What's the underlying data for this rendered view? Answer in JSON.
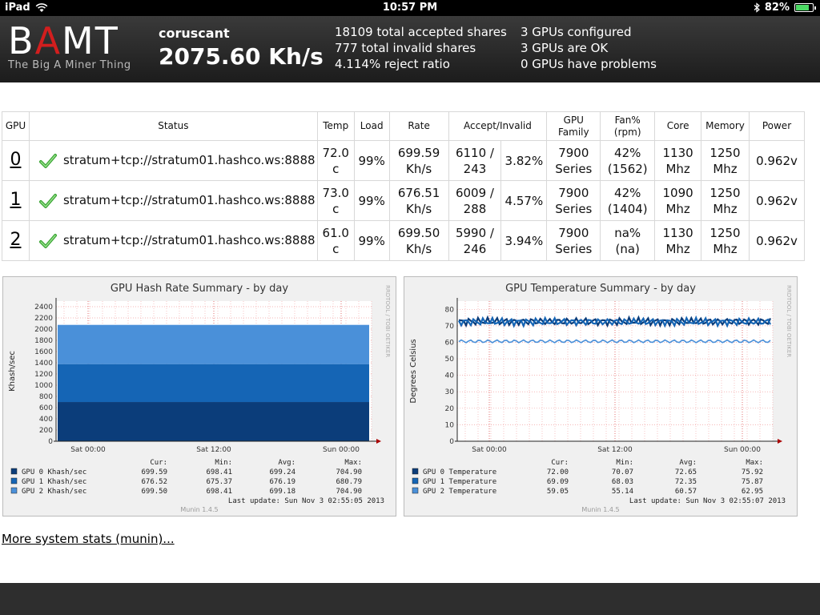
{
  "status_bar": {
    "device": "iPad",
    "time": "10:57 PM",
    "battery": "82%",
    "battery_level": 0.82
  },
  "header": {
    "logo_main": "BAMT",
    "logo_sub": "The Big A Miner Thing",
    "host": "coruscant",
    "hashrate": "2075.60 Kh/s",
    "accepted": "18109 total accepted shares",
    "invalid": "777 total invalid shares",
    "reject": "4.114% reject ratio",
    "configured": "3 GPUs configured",
    "ok": "3 GPUs are OK",
    "problems": "0 GPUs have problems"
  },
  "table": {
    "headers": {
      "gpu": "GPU",
      "status": "Status",
      "temp": "Temp",
      "load": "Load",
      "rate": "Rate",
      "accept": "Accept/Invalid",
      "family_1": "GPU",
      "family_2": "Family",
      "fan_1": "Fan%",
      "fan_2": "(rpm)",
      "core": "Core",
      "memory": "Memory",
      "power": "Power"
    },
    "rows": [
      {
        "gpu": "0",
        "status": "stratum+tcp://stratum01.hashco.ws:8888",
        "temp_1": "72.0",
        "temp_2": "c",
        "load": "99%",
        "rate_1": "699.59",
        "rate_2": "Kh/s",
        "acc_1": "6110 /",
        "acc_2": "243",
        "rej": "3.82%",
        "fam_1": "7900",
        "fam_2": "Series",
        "fan_1": "42%",
        "fan_2": "(1562)",
        "core_1": "1130",
        "core_2": "Mhz",
        "mem_1": "1250",
        "mem_2": "Mhz",
        "power": "0.962v"
      },
      {
        "gpu": "1",
        "status": "stratum+tcp://stratum01.hashco.ws:8888",
        "temp_1": "73.0",
        "temp_2": "c",
        "load": "99%",
        "rate_1": "676.51",
        "rate_2": "Kh/s",
        "acc_1": "6009 /",
        "acc_2": "288",
        "rej": "4.57%",
        "fam_1": "7900",
        "fam_2": "Series",
        "fan_1": "42%",
        "fan_2": "(1404)",
        "core_1": "1090",
        "core_2": "Mhz",
        "mem_1": "1250",
        "mem_2": "Mhz",
        "power": "0.962v"
      },
      {
        "gpu": "2",
        "status": "stratum+tcp://stratum01.hashco.ws:8888",
        "temp_1": "61.0",
        "temp_2": "c",
        "load": "99%",
        "rate_1": "699.50",
        "rate_2": "Kh/s",
        "acc_1": "5990 /",
        "acc_2": "246",
        "rej": "3.94%",
        "fam_1": "7900",
        "fam_2": "Series",
        "fan_1": "na%",
        "fan_2": "(na)",
        "core_1": "1130",
        "core_2": "Mhz",
        "mem_1": "1250",
        "mem_2": "Mhz",
        "power": "0.962v"
      }
    ]
  },
  "hash_chart": {
    "title": "GPU Hash Rate Summary - by day",
    "ylabel": "Khash/sec",
    "side_label": "RRDTOOL / TOBI OETIKER",
    "y_ticks": [
      "0",
      "200",
      "400",
      "600",
      "800",
      "1000",
      "1200",
      "1400",
      "1600",
      "1800",
      "2000",
      "2200",
      "2400"
    ],
    "ylim": [
      0,
      2500
    ],
    "x_ticks": [
      "Sat 00:00",
      "Sat 12:00",
      "Sun 00:00"
    ],
    "stack_values": [
      699.59,
      676.52,
      699.5
    ],
    "colors": [
      "#0b3d7a",
      "#1565b5",
      "#4a90d9"
    ],
    "col_headers": [
      "Cur:",
      "Min:",
      "Avg:",
      "Max:"
    ],
    "legend": [
      {
        "name": "GPU 0 Khash/sec",
        "cur": "699.59",
        "min": "698.41",
        "avg": "699.24",
        "max": "704.90"
      },
      {
        "name": "GPU 1 Khash/sec",
        "cur": "676.52",
        "min": "675.37",
        "avg": "676.19",
        "max": "680.79"
      },
      {
        "name": "GPU 2 Khash/sec",
        "cur": "699.50",
        "min": "698.41",
        "avg": "699.18",
        "max": "704.90"
      }
    ],
    "last_update": "Last update:  Sun Nov  3 02:55:05 2013",
    "munin": "Munin 1.4.5"
  },
  "temp_chart": {
    "title": "GPU Temperature Summary - by day",
    "ylabel": "Degrees Celsius",
    "side_label": "RRDTOOL / TOBI OETIKER",
    "y_ticks": [
      "0",
      "10",
      "20",
      "30",
      "40",
      "50",
      "60",
      "70",
      "80"
    ],
    "ylim": [
      0,
      85
    ],
    "x_ticks": [
      "Sat 00:00",
      "Sat 12:00",
      "Sun 00:00"
    ],
    "lines": [
      72.6,
      72.4,
      60.6
    ],
    "colors": [
      "#0b3d7a",
      "#1565b5",
      "#4a90d9"
    ],
    "col_headers": [
      "Cur:",
      "Min:",
      "Avg:",
      "Max:"
    ],
    "legend": [
      {
        "name": "GPU 0 Temperature",
        "cur": "72.00",
        "min": "70.07",
        "avg": "72.65",
        "max": "75.92"
      },
      {
        "name": "GPU 1 Temperature",
        "cur": "69.09",
        "min": "68.03",
        "avg": "72.35",
        "max": "75.87"
      },
      {
        "name": "GPU 2 Temperature",
        "cur": "59.05",
        "min": "55.14",
        "avg": "60.57",
        "max": "62.95"
      }
    ],
    "last_update": "Last update:  Sun Nov  3 02:55:07 2013",
    "munin": "Munin 1.4.5"
  },
  "chart_data": [
    {
      "type": "area",
      "title": "GPU Hash Rate Summary - by day",
      "ylabel": "Khash/sec",
      "x": [
        "Sat 00:00",
        "Sat 12:00",
        "Sun 00:00"
      ],
      "ylim": [
        0,
        2500
      ],
      "series": [
        {
          "name": "GPU 0 Khash/sec",
          "values": [
            699.59,
            699.59,
            699.59
          ]
        },
        {
          "name": "GPU 1 Khash/sec",
          "values": [
            676.52,
            676.52,
            676.52
          ]
        },
        {
          "name": "GPU 2 Khash/sec",
          "values": [
            699.5,
            699.5,
            699.5
          ]
        }
      ]
    },
    {
      "type": "line",
      "title": "GPU Temperature Summary - by day",
      "ylabel": "Degrees Celsius",
      "x": [
        "Sat 00:00",
        "Sat 12:00",
        "Sun 00:00"
      ],
      "ylim": [
        0,
        85
      ],
      "series": [
        {
          "name": "GPU 0 Temperature",
          "values": [
            72.65,
            72.65,
            72.65
          ]
        },
        {
          "name": "GPU 1 Temperature",
          "values": [
            72.35,
            72.35,
            72.35
          ]
        },
        {
          "name": "GPU 2 Temperature",
          "values": [
            60.57,
            60.57,
            60.57
          ]
        }
      ]
    }
  ],
  "more_link": "More system stats (munin)..."
}
